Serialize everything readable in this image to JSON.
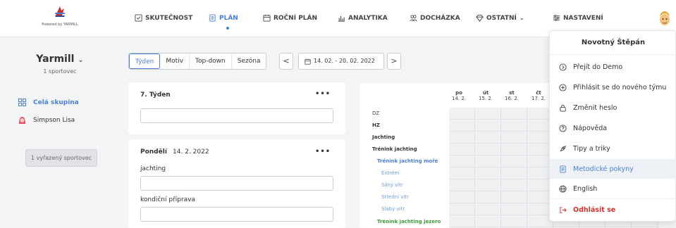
{
  "logo": {
    "caption": "Powered by YARMILL"
  },
  "nav": {
    "items": [
      {
        "label": "SKUTEČNOST",
        "icon": "checklist-icon"
      },
      {
        "label": "PLÁN",
        "icon": "plan-icon",
        "active": true
      },
      {
        "label": "ROČNÍ PLÁN",
        "icon": "calendar-icon"
      },
      {
        "label": "ANALYTIKA",
        "icon": "chart-icon"
      },
      {
        "label": "DOCHÁZKA",
        "icon": "attendance-icon"
      },
      {
        "label": "OSTATNÍ",
        "icon": "diamond-icon",
        "has_dropdown": true
      },
      {
        "label": "NASTAVENÍ",
        "icon": "settings-sliders-icon"
      }
    ]
  },
  "sidebar": {
    "group_title": "Yarmill",
    "group_sub": "1 sportovec",
    "items": [
      {
        "label": "Celá skupina",
        "icon": "grid-icon",
        "color": "#4a7fd4"
      },
      {
        "label": "Simpson Lisa",
        "icon": "avatar-icon",
        "color": "#333333"
      }
    ],
    "retired_button": "1 vyřazený sportovec"
  },
  "toolbar": {
    "view_tabs": [
      "Týden",
      "Motiv",
      "Top-down",
      "Sezóna"
    ],
    "active_tab": "Týden",
    "prev": "<",
    "next": ">",
    "date_range": "14. 02. - 20. 02. 2022"
  },
  "week_card": {
    "title": "7. Týden",
    "menu": "•••"
  },
  "day_card": {
    "day_name": "Pondělí",
    "date": "14. 2. 2022",
    "menu": "•••",
    "fields": [
      {
        "label": "jachting"
      },
      {
        "label": "kondiční příprava"
      }
    ]
  },
  "grid": {
    "days": [
      {
        "name": "po",
        "date": "14. 2."
      },
      {
        "name": "út",
        "date": "15. 2."
      },
      {
        "name": "st",
        "date": "16. 2."
      },
      {
        "name": "čt",
        "date": "17. 2."
      }
    ],
    "rows": [
      {
        "label": "DZ",
        "style": "plain"
      },
      {
        "label": "HZ",
        "style": "bold"
      },
      {
        "label": "Jachting",
        "style": "bold"
      },
      {
        "label": "Trénink jachting",
        "style": "bold"
      },
      {
        "label": "Trénink jachting moře",
        "style": "blue-bold"
      },
      {
        "label": "Extrém",
        "style": "blue"
      },
      {
        "label": "Silný vítr",
        "style": "blue"
      },
      {
        "label": "Střední vítr",
        "style": "blue"
      },
      {
        "label": "Slabý vítr",
        "style": "blue"
      },
      {
        "label": "Trénink jachting jezero",
        "style": "green-bold"
      }
    ]
  },
  "user_menu": {
    "name": "Novotný Štěpán",
    "items": [
      {
        "label": "Přejít do Demo",
        "icon": "circle-arrow-icon"
      },
      {
        "label": "Přihlásit se do nového týmu",
        "icon": "circle-plus-icon"
      },
      {
        "label": "Změnit heslo",
        "icon": "lock-icon"
      },
      {
        "label": "Nápověda",
        "icon": "help-icon"
      },
      {
        "label": "Tipy a triky",
        "icon": "rocket-icon"
      },
      {
        "label": "Metodické pokyny",
        "icon": "document-icon",
        "highlight": true
      },
      {
        "label": "English",
        "icon": "globe-icon"
      },
      {
        "label": "Odhlásit se",
        "icon": "logout-icon",
        "danger": true
      }
    ]
  },
  "colors": {
    "accent": "#4a7fd4",
    "danger": "#d0312d",
    "green": "#3e9a3a",
    "background": "#f3f4f6"
  }
}
